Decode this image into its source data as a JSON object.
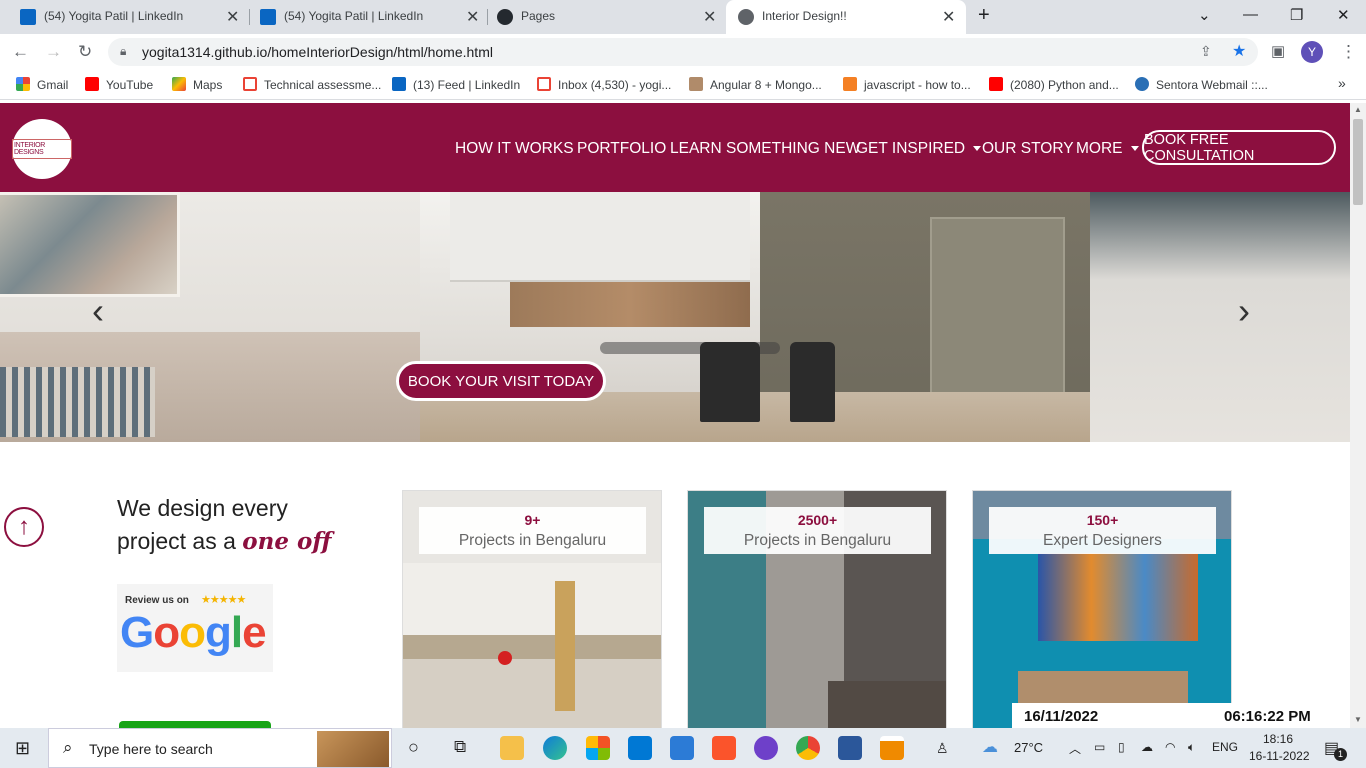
{
  "browser": {
    "tabs": [
      {
        "label": "(54) Yogita Patil | LinkedIn",
        "icon": "linkedin-icon"
      },
      {
        "label": "(54) Yogita Patil | LinkedIn",
        "icon": "linkedin-icon"
      },
      {
        "label": "Pages",
        "icon": "github-icon"
      },
      {
        "label": "Interior Design!!",
        "icon": "globe-icon",
        "active": true
      }
    ],
    "new_tab": "+",
    "url": "yogita1314.github.io/homeInteriorDesign/html/home.html",
    "profile_initial": "Y",
    "bookmarks": [
      {
        "label": "Gmail",
        "icon": "google-icon"
      },
      {
        "label": "YouTube",
        "icon": "youtube-icon"
      },
      {
        "label": "Maps",
        "icon": "maps-icon"
      },
      {
        "label": "Technical assessme...",
        "icon": "gmail-icon"
      },
      {
        "label": "(13) Feed | LinkedIn",
        "icon": "linkedin-icon"
      },
      {
        "label": "Inbox (4,530) - yogi...",
        "icon": "gmail-icon"
      },
      {
        "label": "Angular 8 + Mongo...",
        "icon": "site-icon"
      },
      {
        "label": "javascript - how to...",
        "icon": "stackoverflow-icon"
      },
      {
        "label": "(2080) Python and...",
        "icon": "youtube-icon"
      },
      {
        "label": "Sentora Webmail ::...",
        "icon": "webmail-icon"
      }
    ],
    "more_bookmarks": "»"
  },
  "site": {
    "logo_text": "INTERIOR DESIGNS",
    "nav": {
      "how": "HOW IT WORKS",
      "portfolio": "PORTFOLIO",
      "learn": "LEARN SOMETHING NEW",
      "inspired": "GET INSPIRED",
      "story": "OUR STORY",
      "more": "MORE",
      "consult": "BOOK FREE CONSULTATION"
    },
    "hero": {
      "visit_button": "BOOK YOUR VISIT TODAY",
      "prev": "‹",
      "next": "›"
    },
    "headline": {
      "line1": "We design every",
      "line2": "project as a",
      "fancy": "one off"
    },
    "review": {
      "label": "Review us on",
      "stars": "★★★★★",
      "brand": "Google"
    },
    "cards": [
      {
        "num": "9+",
        "text": "Projects in Bengaluru"
      },
      {
        "num": "2500+",
        "text": "Projects in Bengaluru"
      },
      {
        "num": "150+",
        "text": "Expert Designers"
      }
    ],
    "date": "16/11/2022",
    "time": "06:16:22 PM",
    "scroll_top": "↑"
  },
  "taskbar": {
    "search_placeholder": "Type here to search",
    "weather": "27°C",
    "lang": "ENG",
    "clock_time": "18:16",
    "clock_date": "16-11-2022",
    "notifications": "1"
  },
  "colors": {
    "brand": "#8c0f3f",
    "accent_green": "#18a418"
  }
}
